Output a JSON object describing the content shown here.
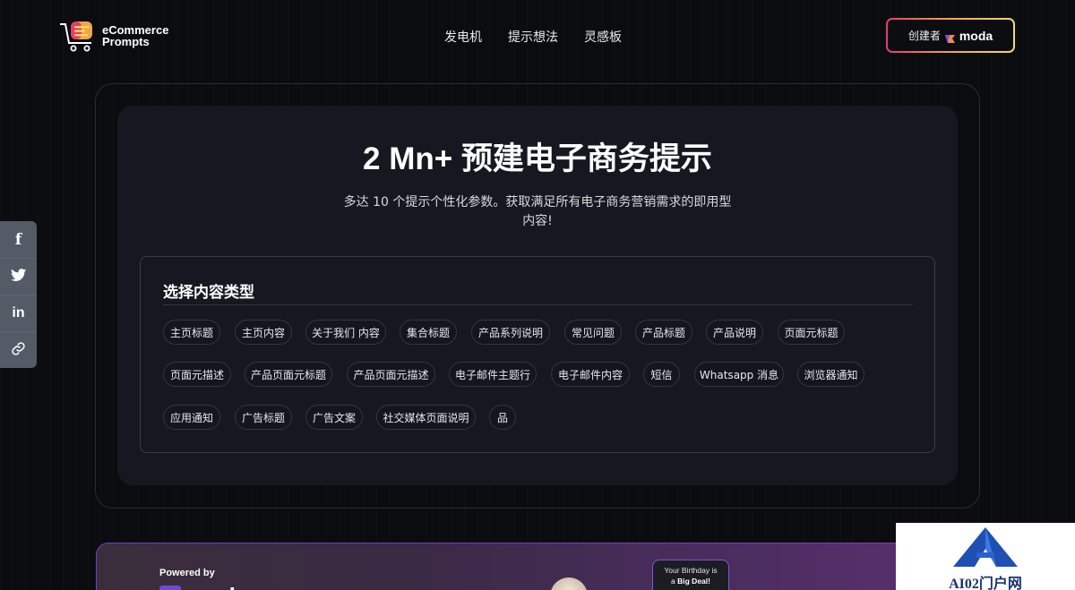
{
  "brand": {
    "line1": "eCommerce",
    "line2": "Prompts",
    "colors": {
      "orange": "#f2a54a",
      "pink": "#e63b6b",
      "yellow": "#f7d96a"
    }
  },
  "nav": [
    {
      "label": "发电机"
    },
    {
      "label": "提示想法"
    },
    {
      "label": "灵感板"
    }
  ],
  "creator": {
    "label": "创建者",
    "brand": "moda"
  },
  "hero": {
    "title": "2 Mn+ 预建电子商务提示",
    "subtitle_line1": "多达 10 个提示个性化参数。获取满足所有电子商务营销需求的即用型",
    "subtitle_line2": "内容!"
  },
  "content_types": {
    "title": "选择内容类型",
    "chips": [
      {
        "label": "主页标题"
      },
      {
        "label": "主页内容"
      },
      {
        "label": "关于我们 内容"
      },
      {
        "label": "集合标题"
      },
      {
        "label": "产品系列说明"
      },
      {
        "label": "常见问题"
      },
      {
        "label": "产品标题"
      },
      {
        "label": "产品说明"
      },
      {
        "label": "页面元标题"
      },
      {
        "label": "页面元描述"
      },
      {
        "label": "产品页面元标题"
      },
      {
        "label": "产品页面元描述"
      },
      {
        "label": "电子邮件主题行"
      },
      {
        "label": "电子邮件内容"
      },
      {
        "label": "短信"
      },
      {
        "label": "Whatsapp 消息"
      },
      {
        "label": "浏览器通知"
      },
      {
        "label": "应用通知"
      },
      {
        "label": "广告标题"
      },
      {
        "label": "广告文案"
      },
      {
        "label": "社交媒体页面说明"
      },
      {
        "label": "品"
      }
    ]
  },
  "social": [
    {
      "icon": "facebook-icon",
      "glyph": "f"
    },
    {
      "icon": "twitter-icon",
      "glyph": "🐦"
    },
    {
      "icon": "linkedin-icon",
      "glyph": "in"
    },
    {
      "icon": "link-icon",
      "glyph": "🔗"
    }
  ],
  "banner": {
    "powered_by": "Powered by",
    "logo_text": "moda",
    "promo_line1": "Your Birthday is",
    "promo_line2_prefix": "a ",
    "promo_line2_bold": "Big Deal!"
  },
  "watermark": {
    "text": "AI02门户网"
  }
}
